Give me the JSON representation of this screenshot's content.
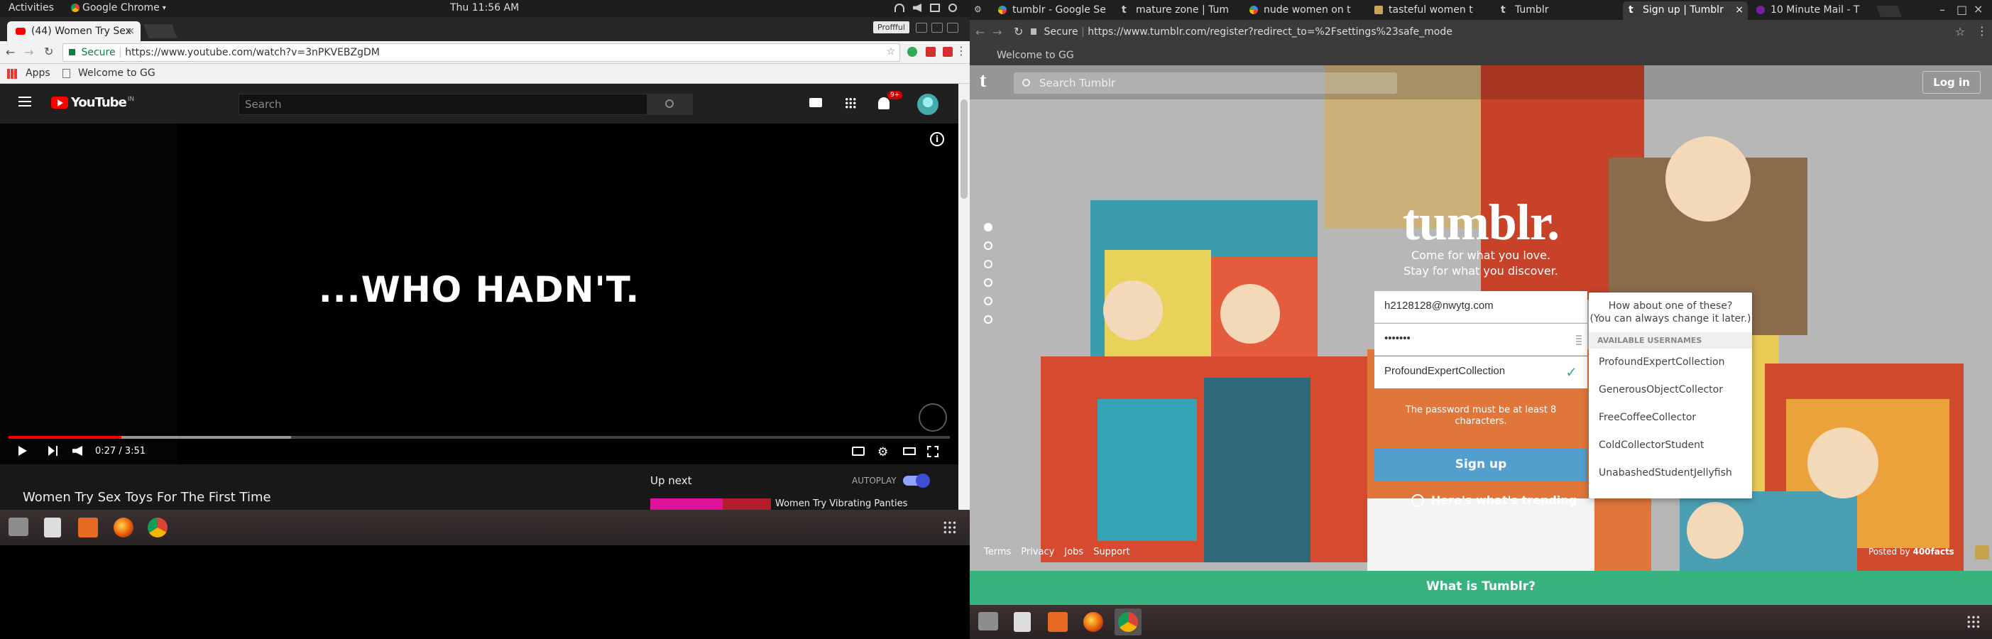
{
  "left_screen": {
    "gnome_bar": {
      "activities": "Activities",
      "app_menu": "Google Chrome",
      "clock": "Thu 11:56 AM"
    },
    "chrome": {
      "tab_title": "(44) Women Try Sex",
      "profile_label": "Proffful",
      "url_secure_label": "Secure",
      "url": "https://www.youtube.com/watch?v=3nPKVEBZgDM",
      "bookmarks": [
        {
          "label": "Apps"
        },
        {
          "label": "Welcome to GG"
        }
      ]
    },
    "youtube": {
      "logo_text": "YouTube",
      "logo_region": "IN",
      "search_placeholder": "Search",
      "notification_count": "9+",
      "video_caption": "...WHO HADN'T.",
      "time_display": "0:27 / 3:51",
      "progress": {
        "played_fraction": 0.12,
        "buffered_fraction": 0.3
      },
      "video_title": "Women Try Sex Toys For The First Time",
      "up_next_label": "Up next",
      "autoplay_label": "AUTOPLAY",
      "next_video_title": "Women Try Vibrating Panties"
    }
  },
  "right_screen": {
    "tabs": [
      {
        "label": "tumblr - Google Se",
        "icon": "google-icon"
      },
      {
        "label": "mature zone | Tum",
        "icon": "tumblr-icon"
      },
      {
        "label": "nude women on t",
        "icon": "google-icon"
      },
      {
        "label": "tasteful women t",
        "icon": "photo-icon"
      },
      {
        "label": "Tumblr",
        "icon": "tumblr-icon"
      },
      {
        "label": "Sign up | Tumblr",
        "icon": "tumblr-icon",
        "active": true
      },
      {
        "label": "10 Minute Mail - T",
        "icon": "mail-icon"
      }
    ],
    "url_secure_label": "Secure",
    "url": "https://www.tumblr.com/register?redirect_to=%2Fsettings%23safe_mode",
    "bookmark": "Welcome to GG",
    "tumblr": {
      "search_placeholder": "Search Tumblr",
      "login_label": "Log in",
      "logo": "tumblr.",
      "tagline_1": "Come for what you love.",
      "tagline_2": "Stay for what you discover.",
      "email_value": "h2128128@nwytg.com",
      "password_value": "•••••••",
      "username_value": "ProfoundExpertCollection",
      "password_error": "The password must be at least 8 characters.",
      "signup_label": "Sign up",
      "trending_label": "Here's what's trending",
      "suggestions_header": "How about one of these?",
      "suggestions_subheader": "(You can always change it later.)",
      "suggestions_section": "AVAILABLE USERNAMES",
      "suggestions": [
        "ProfoundExpertCollection",
        "GenerousObjectCollector",
        "FreeCoffeeCollector",
        "ColdCollectorStudent",
        "UnabashedStudentJellyfish"
      ],
      "footer_links": [
        "Terms",
        "Privacy",
        "Jobs",
        "Support"
      ],
      "posted_by_prefix": "Posted by",
      "posted_by_user": "400facts",
      "what_is": "What is Tumblr?",
      "slide_dots_count": 6
    },
    "colors": {
      "tumblr_green": "#36b37e",
      "tumblr_blue": "#529ecc",
      "youtube_red": "#ff0000"
    }
  }
}
